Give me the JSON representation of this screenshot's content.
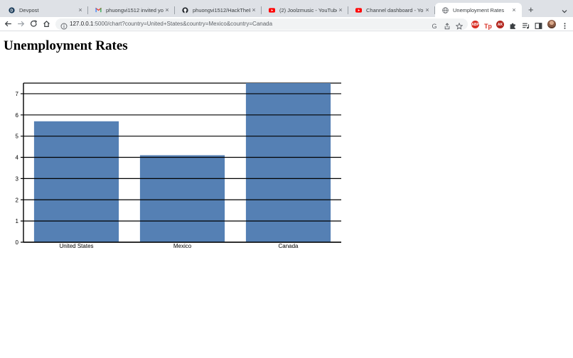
{
  "browser": {
    "tabs": [
      {
        "title": "Devpost",
        "icon": "devpost-icon",
        "active": false
      },
      {
        "title": "phuongvi1512 invited you to",
        "icon": "gmail-icon",
        "active": false
      },
      {
        "title": "phuongvi1512/HackTheBrea",
        "icon": "github-icon",
        "active": false
      },
      {
        "title": "(2) Joolzmusic - YouTube",
        "icon": "youtube-icon",
        "active": false
      },
      {
        "title": "Channel dashboard - YouTu",
        "icon": "youtube-icon",
        "active": false
      },
      {
        "title": "Unemployment Rates",
        "icon": "globe-icon",
        "active": true
      }
    ],
    "close_glyph": "×",
    "new_tab_glyph": "+",
    "url_host": "127.0.0.1",
    "url_rest": ":5000/chart?country=United+States&country=Mexico&country=Canada"
  },
  "page": {
    "title": "Unemployment Rates"
  },
  "chart_data": {
    "type": "bar",
    "title": "",
    "xlabel": "",
    "ylabel": "",
    "categories": [
      "United States",
      "Mexico",
      "Canada"
    ],
    "values": [
      5.7,
      4.1,
      7.5
    ],
    "ylim": [
      0,
      7.5
    ],
    "yticks": [
      0,
      1,
      2,
      3,
      4,
      5,
      6,
      7
    ],
    "grid": true,
    "bar_color": "#5580b4"
  },
  "colors": {
    "tabstrip": "#dee1e6",
    "omnibox": "#f1f3f4",
    "bar": "#5580b4"
  }
}
